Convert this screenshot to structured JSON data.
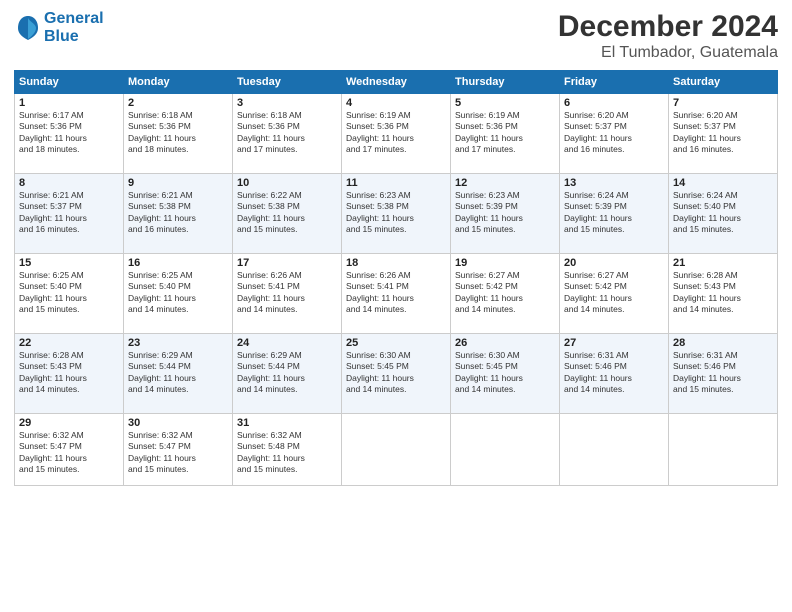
{
  "header": {
    "logo_line1": "General",
    "logo_line2": "Blue",
    "month": "December 2024",
    "location": "El Tumbador, Guatemala"
  },
  "weekdays": [
    "Sunday",
    "Monday",
    "Tuesday",
    "Wednesday",
    "Thursday",
    "Friday",
    "Saturday"
  ],
  "weeks": [
    [
      {
        "day": "1",
        "info": "Sunrise: 6:17 AM\nSunset: 5:36 PM\nDaylight: 11 hours\nand 18 minutes."
      },
      {
        "day": "2",
        "info": "Sunrise: 6:18 AM\nSunset: 5:36 PM\nDaylight: 11 hours\nand 18 minutes."
      },
      {
        "day": "3",
        "info": "Sunrise: 6:18 AM\nSunset: 5:36 PM\nDaylight: 11 hours\nand 17 minutes."
      },
      {
        "day": "4",
        "info": "Sunrise: 6:19 AM\nSunset: 5:36 PM\nDaylight: 11 hours\nand 17 minutes."
      },
      {
        "day": "5",
        "info": "Sunrise: 6:19 AM\nSunset: 5:36 PM\nDaylight: 11 hours\nand 17 minutes."
      },
      {
        "day": "6",
        "info": "Sunrise: 6:20 AM\nSunset: 5:37 PM\nDaylight: 11 hours\nand 16 minutes."
      },
      {
        "day": "7",
        "info": "Sunrise: 6:20 AM\nSunset: 5:37 PM\nDaylight: 11 hours\nand 16 minutes."
      }
    ],
    [
      {
        "day": "8",
        "info": "Sunrise: 6:21 AM\nSunset: 5:37 PM\nDaylight: 11 hours\nand 16 minutes."
      },
      {
        "day": "9",
        "info": "Sunrise: 6:21 AM\nSunset: 5:38 PM\nDaylight: 11 hours\nand 16 minutes."
      },
      {
        "day": "10",
        "info": "Sunrise: 6:22 AM\nSunset: 5:38 PM\nDaylight: 11 hours\nand 15 minutes."
      },
      {
        "day": "11",
        "info": "Sunrise: 6:23 AM\nSunset: 5:38 PM\nDaylight: 11 hours\nand 15 minutes."
      },
      {
        "day": "12",
        "info": "Sunrise: 6:23 AM\nSunset: 5:39 PM\nDaylight: 11 hours\nand 15 minutes."
      },
      {
        "day": "13",
        "info": "Sunrise: 6:24 AM\nSunset: 5:39 PM\nDaylight: 11 hours\nand 15 minutes."
      },
      {
        "day": "14",
        "info": "Sunrise: 6:24 AM\nSunset: 5:40 PM\nDaylight: 11 hours\nand 15 minutes."
      }
    ],
    [
      {
        "day": "15",
        "info": "Sunrise: 6:25 AM\nSunset: 5:40 PM\nDaylight: 11 hours\nand 15 minutes."
      },
      {
        "day": "16",
        "info": "Sunrise: 6:25 AM\nSunset: 5:40 PM\nDaylight: 11 hours\nand 14 minutes."
      },
      {
        "day": "17",
        "info": "Sunrise: 6:26 AM\nSunset: 5:41 PM\nDaylight: 11 hours\nand 14 minutes."
      },
      {
        "day": "18",
        "info": "Sunrise: 6:26 AM\nSunset: 5:41 PM\nDaylight: 11 hours\nand 14 minutes."
      },
      {
        "day": "19",
        "info": "Sunrise: 6:27 AM\nSunset: 5:42 PM\nDaylight: 11 hours\nand 14 minutes."
      },
      {
        "day": "20",
        "info": "Sunrise: 6:27 AM\nSunset: 5:42 PM\nDaylight: 11 hours\nand 14 minutes."
      },
      {
        "day": "21",
        "info": "Sunrise: 6:28 AM\nSunset: 5:43 PM\nDaylight: 11 hours\nand 14 minutes."
      }
    ],
    [
      {
        "day": "22",
        "info": "Sunrise: 6:28 AM\nSunset: 5:43 PM\nDaylight: 11 hours\nand 14 minutes."
      },
      {
        "day": "23",
        "info": "Sunrise: 6:29 AM\nSunset: 5:44 PM\nDaylight: 11 hours\nand 14 minutes."
      },
      {
        "day": "24",
        "info": "Sunrise: 6:29 AM\nSunset: 5:44 PM\nDaylight: 11 hours\nand 14 minutes."
      },
      {
        "day": "25",
        "info": "Sunrise: 6:30 AM\nSunset: 5:45 PM\nDaylight: 11 hours\nand 14 minutes."
      },
      {
        "day": "26",
        "info": "Sunrise: 6:30 AM\nSunset: 5:45 PM\nDaylight: 11 hours\nand 14 minutes."
      },
      {
        "day": "27",
        "info": "Sunrise: 6:31 AM\nSunset: 5:46 PM\nDaylight: 11 hours\nand 14 minutes."
      },
      {
        "day": "28",
        "info": "Sunrise: 6:31 AM\nSunset: 5:46 PM\nDaylight: 11 hours\nand 15 minutes."
      }
    ],
    [
      {
        "day": "29",
        "info": "Sunrise: 6:32 AM\nSunset: 5:47 PM\nDaylight: 11 hours\nand 15 minutes."
      },
      {
        "day": "30",
        "info": "Sunrise: 6:32 AM\nSunset: 5:47 PM\nDaylight: 11 hours\nand 15 minutes."
      },
      {
        "day": "31",
        "info": "Sunrise: 6:32 AM\nSunset: 5:48 PM\nDaylight: 11 hours\nand 15 minutes."
      },
      {
        "day": "",
        "info": ""
      },
      {
        "day": "",
        "info": ""
      },
      {
        "day": "",
        "info": ""
      },
      {
        "day": "",
        "info": ""
      }
    ]
  ]
}
